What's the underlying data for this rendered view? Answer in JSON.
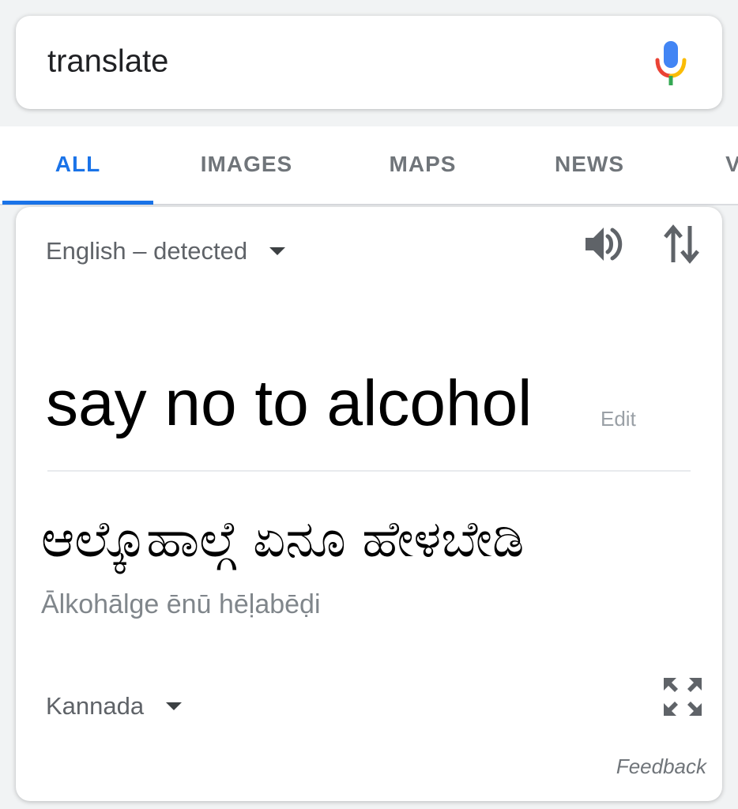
{
  "search": {
    "query": "translate"
  },
  "tabs": [
    {
      "label": "ALL",
      "active": true
    },
    {
      "label": "IMAGES",
      "active": false
    },
    {
      "label": "MAPS",
      "active": false
    },
    {
      "label": "NEWS",
      "active": false
    },
    {
      "label": "V",
      "active": false
    }
  ],
  "translate": {
    "source_language": "English – detected",
    "source_text": "say no to alcohol",
    "edit_label": "Edit",
    "translated_text": "ಆಲ್ಕೊಹಾಲ್ಗೆ ಏನೂ ಹೇಳಬೇಡಿ",
    "transliteration": "Ālkohālge ēnū hēḷabēḍi",
    "target_language": "Kannada",
    "feedback_label": "Feedback"
  },
  "icons": {
    "mic": "mic-icon",
    "speaker": "speaker-icon",
    "swap": "swap-languages-icon",
    "expand": "expand-icon",
    "dropdown": "dropdown-arrow-icon"
  },
  "colors": {
    "accent_blue": "#1a73e8",
    "mic_blue": "#4285f4",
    "mic_red": "#ea4335",
    "mic_yellow": "#fbbc05",
    "mic_green": "#34a853",
    "tab_inactive": "#70757a",
    "secondary_text": "#5f6368"
  }
}
